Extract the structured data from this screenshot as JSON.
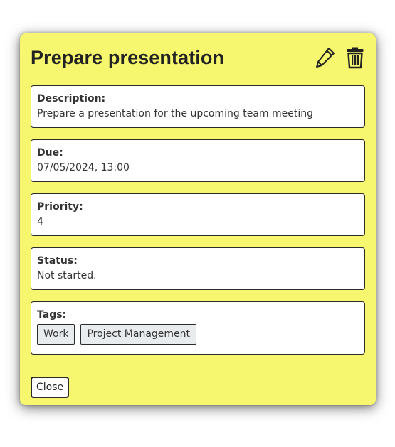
{
  "task": {
    "title": "Prepare presentation",
    "description_label": "Description:",
    "description": "Prepare a presentation for the upcoming team meeting",
    "due_label": "Due:",
    "due": "07/05/2024, 13:00",
    "priority_label": "Priority:",
    "priority": "4",
    "status_label": "Status:",
    "status": "Not started.",
    "tags_label": "Tags:",
    "tags": [
      "Work",
      "Project Management"
    ]
  },
  "actions": {
    "edit_icon": "pencil-icon",
    "delete_icon": "trash-icon",
    "close_label": "Close"
  },
  "colors": {
    "modal_background": "#f6f66f",
    "card_background": "#ffffff",
    "tag_background": "#e9ecef",
    "border": "#2b2b2b"
  }
}
